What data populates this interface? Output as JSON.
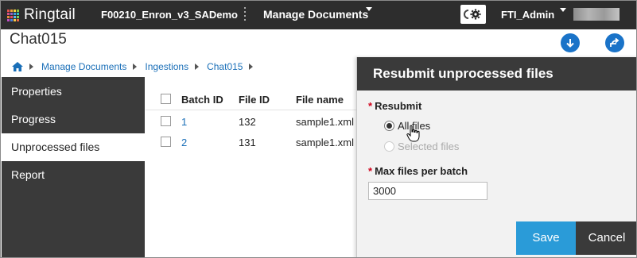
{
  "app": {
    "logo_text": "Ringtail",
    "case_name": "F00210_Enron_v3_SADemo",
    "module": "Manage Documents",
    "user": "FTI_Admin"
  },
  "header": {
    "title": "Chat015",
    "breadcrumb": [
      "Manage Documents",
      "Ingestions",
      "Chat015"
    ]
  },
  "sidebar": {
    "items": [
      {
        "label": "Properties"
      },
      {
        "label": "Progress"
      },
      {
        "label": "Unprocessed files"
      },
      {
        "label": "Report"
      }
    ]
  },
  "table": {
    "headers": [
      "Batch ID",
      "File ID",
      "File name"
    ],
    "rows": [
      {
        "batch_id": "1",
        "file_id": "132",
        "file_name": "sample1.xml"
      },
      {
        "batch_id": "2",
        "file_id": "131",
        "file_name": "sample1.xml"
      }
    ]
  },
  "panel": {
    "title": "Resubmit unprocessed files",
    "resubmit_label": "Resubmit",
    "options": [
      "All files",
      "Selected files"
    ],
    "selected_option": "All files",
    "max_files_label": "Max files per batch",
    "max_files_value": "3000",
    "save_label": "Save",
    "cancel_label": "Cancel"
  },
  "colors": {
    "topbar": "#2d2d2d",
    "sidebar": "#3a3a3a",
    "accent": "#2a9bd8",
    "link": "#1a6fb8",
    "required": "#d0021b"
  }
}
